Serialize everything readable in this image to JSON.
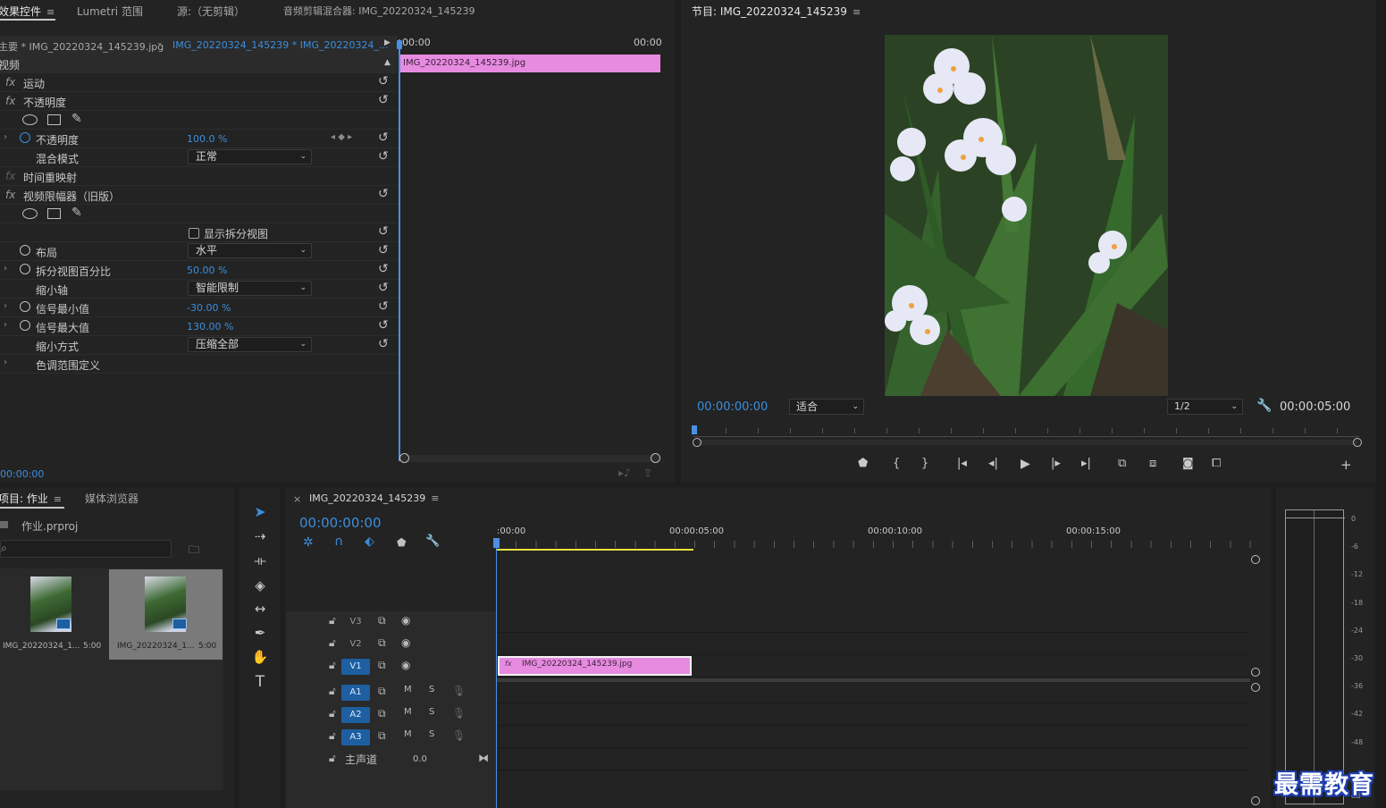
{
  "effect_controls": {
    "tabs": [
      "效果控件",
      "Lumetri 范围",
      "源:（无剪辑）",
      "音频剪辑混合器: IMG_20220324_145239"
    ],
    "menu_glyph": "≡",
    "master_clip": "主要 * IMG_20220324_145239.jpg",
    "sequence_clip": "IMG_20220324_145239 * IMG_20220324_...",
    "timecode_start": "00:00",
    "timecode_end": "00:00",
    "clip_bar_label": "IMG_20220324_145239.jpg",
    "section_video": "视频",
    "fx_motion": "运动",
    "fx_opacity": "不透明度",
    "opacity_label": "不透明度",
    "opacity_value": "100.0 %",
    "blend_label": "混合模式",
    "blend_value": "正常",
    "time_remap": "时间重映射",
    "video_limiter": "视频限幅器（旧版）",
    "show_split": "显示拆分视图",
    "layout_label": "布局",
    "layout_value": "水平",
    "split_pct_label": "拆分视图百分比",
    "split_pct_value": "50.00 %",
    "reduce_axis_label": "缩小轴",
    "reduce_axis_value": "智能限制",
    "signal_min_label": "信号最小值",
    "signal_min_value": "-30.00 %",
    "signal_max_label": "信号最大值",
    "signal_max_value": "130.00 %",
    "reduce_method_label": "缩小方式",
    "reduce_method_value": "压缩全部",
    "tonal_range": "色调范围定义",
    "bottom_timecode": "00:00:00"
  },
  "program_monitor": {
    "title": "节目: IMG_20220324_145239",
    "current_time": "00:00:00:00",
    "fit_label": "适合",
    "resolution": "1/2",
    "duration": "00:00:05:00"
  },
  "project": {
    "tabs": [
      "项目: 作业",
      "媒体浏览器"
    ],
    "project_file": "作业.prproj",
    "search_placeholder": "",
    "items": [
      {
        "name": "IMG_20220324_1...",
        "duration": "5:00"
      },
      {
        "name": "IMG_20220324_1...",
        "duration": "5:00"
      }
    ]
  },
  "timeline": {
    "close_glyph": "×",
    "sequence_name": "IMG_20220324_145239",
    "current_time": "00:00:00:00",
    "ruler": [
      ":00:00",
      "00:00:05:00",
      "00:00:10:00",
      "00:00:15:00"
    ],
    "clip_label": "IMG_20220324_145239.jpg",
    "clip_fx": "fx",
    "video_tracks": [
      "V3",
      "V2",
      "V1"
    ],
    "audio_tracks": [
      "A1",
      "A2",
      "A3"
    ],
    "mute": "M",
    "solo": "S",
    "master_label": "主声道",
    "master_value": "0.0"
  },
  "meter": {
    "labels": [
      "0",
      "-6",
      "-12",
      "-18",
      "-24",
      "-30",
      "-36",
      "-42",
      "-48",
      "dB"
    ]
  },
  "watermark": "最需教育",
  "colors": {
    "accent_blue": "#3b8edc",
    "clip_pink": "#e68be0",
    "playhead": "#4a90e2",
    "work_area": "#e8e040"
  }
}
